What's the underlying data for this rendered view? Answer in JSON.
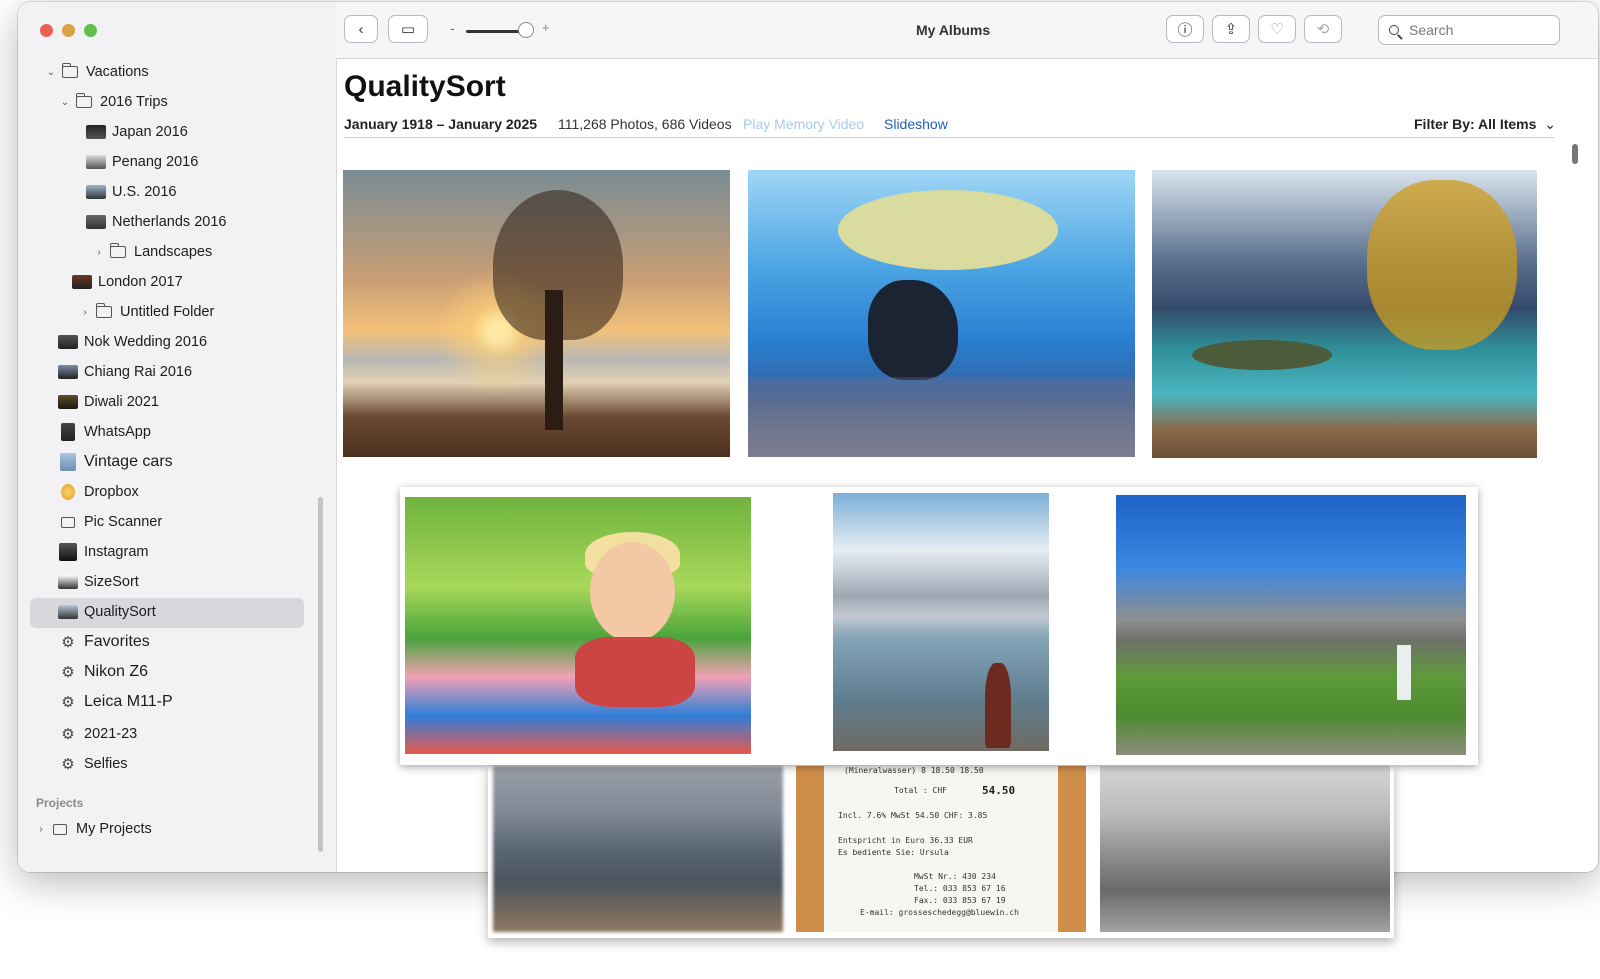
{
  "sidebar": {
    "section_label": "Projects",
    "items": [
      {
        "label": "Vacations"
      },
      {
        "label": "2016 Trips"
      },
      {
        "label": "Japan 2016"
      },
      {
        "label": "Penang 2016"
      },
      {
        "label": "U.S. 2016"
      },
      {
        "label": "Netherlands 2016"
      },
      {
        "label": "Landscapes"
      },
      {
        "label": "London 2017"
      },
      {
        "label": "Untitled Folder"
      },
      {
        "label": "Nok Wedding 2016"
      },
      {
        "label": "Chiang Rai 2016"
      },
      {
        "label": "Diwali 2021"
      },
      {
        "label": "WhatsApp"
      },
      {
        "label": "Vintage cars"
      },
      {
        "label": "Dropbox"
      },
      {
        "label": "Pic Scanner"
      },
      {
        "label": "Instagram"
      },
      {
        "label": "SizeSort"
      },
      {
        "label": "QualitySort"
      },
      {
        "label": "Favorites"
      },
      {
        "label": "Nikon Z6"
      },
      {
        "label": "Leica M11-P"
      },
      {
        "label": "2021-23"
      },
      {
        "label": "Selfies"
      },
      {
        "label": "My Projects"
      }
    ],
    "selected": "QualitySort"
  },
  "toolbar": {
    "title": "My Albums",
    "slider_minus": "-",
    "slider_plus": "+",
    "search_placeholder": "Search"
  },
  "album": {
    "title": "QualitySort",
    "date_range": "January 1918 – January 2025",
    "counts": "111,268 Photos, 686 Videos",
    "play_memory": "Play Memory Video",
    "slideshow": "Slideshow",
    "filter": "Filter By: All Items"
  },
  "receipt": {
    "line0": "(Mineralwasser)         8 18.50   18.50",
    "total_label": "Total :   CHF",
    "total_value": "54.50",
    "line2": "Incl. 7.6% MwSt  54.50 CHF:   3.85",
    "line3": "Entspricht in Euro  36.33  EUR",
    "line4": "Es bediente Sie: Ursula",
    "line5": "MwSt Nr.: 430 234",
    "line6": "Tel.: 033 853 67 16",
    "line7": "Fax.: 033 853 67 19",
    "line8": "E-mail: grosseschedegg@bluewin.ch"
  },
  "colors": {
    "accent": "#1f5fbf",
    "disabled_link": "#a9c9ef",
    "selection": "#d7d7dc"
  }
}
